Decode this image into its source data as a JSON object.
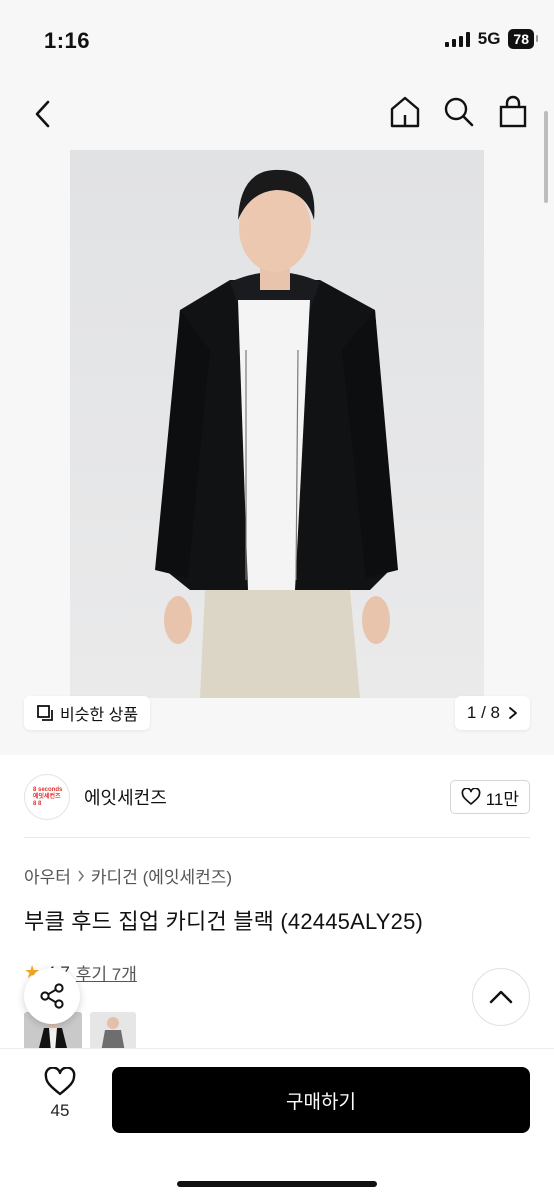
{
  "status_bar": {
    "time": "1:16",
    "network": "5G",
    "battery": "78"
  },
  "nav": {
    "back_icon": "chevron-left-icon",
    "icons": [
      "home-icon",
      "search-icon",
      "shopping-bag-icon"
    ]
  },
  "gallery": {
    "similar_label": "비슷한 상품",
    "page_current": "1",
    "page_separator": "/",
    "page_total": "8",
    "page_text": "1 / 8"
  },
  "brand": {
    "logo_lines": [
      "8 seconds",
      "에잇세컨즈",
      "8 8"
    ],
    "name": "에잇세컨즈",
    "like_count": "11만"
  },
  "breadcrumb": {
    "items": [
      "아우터",
      "카디건 (에잇세컨즈)"
    ]
  },
  "product": {
    "title": "부클 후드 집업 카디건 블랙 (42445ALY25)",
    "rating": "4.7",
    "review_link": "후기 7개"
  },
  "bottom_bar": {
    "wish_count": "45",
    "buy_label": "구매하기"
  },
  "colors": {
    "accent": "#000000",
    "star": "#f5a623",
    "brand_red": "#e03030"
  }
}
